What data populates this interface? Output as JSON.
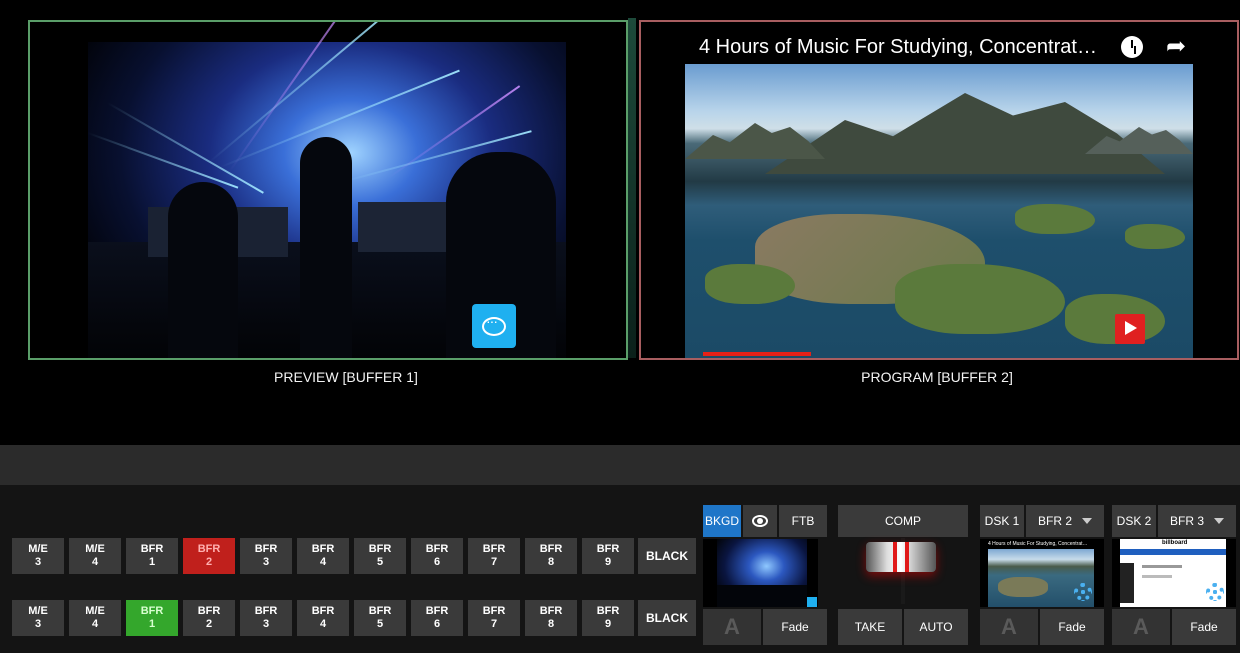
{
  "monitors": {
    "preview": {
      "label": "PREVIEW [BUFFER 1]"
    },
    "program": {
      "label": "PROGRAM [BUFFER 2]",
      "video_title": "4 Hours of Music For Studying, Concentrat…"
    }
  },
  "bus_rows": {
    "program_row": [
      {
        "l1": "M/E",
        "l2": "3",
        "state": "off"
      },
      {
        "l1": "M/E",
        "l2": "4",
        "state": "off"
      },
      {
        "l1": "BFR",
        "l2": "1",
        "state": "off"
      },
      {
        "l1": "BFR",
        "l2": "2",
        "state": "red"
      },
      {
        "l1": "BFR",
        "l2": "3",
        "state": "off"
      },
      {
        "l1": "BFR",
        "l2": "4",
        "state": "off"
      },
      {
        "l1": "BFR",
        "l2": "5",
        "state": "off"
      },
      {
        "l1": "BFR",
        "l2": "6",
        "state": "off"
      },
      {
        "l1": "BFR",
        "l2": "7",
        "state": "off"
      },
      {
        "l1": "BFR",
        "l2": "8",
        "state": "off"
      },
      {
        "l1": "BFR",
        "l2": "9",
        "state": "off"
      },
      {
        "l1": "BLACK",
        "l2": "",
        "state": "off"
      }
    ],
    "preview_row": [
      {
        "l1": "M/E",
        "l2": "3",
        "state": "off"
      },
      {
        "l1": "M/E",
        "l2": "4",
        "state": "off"
      },
      {
        "l1": "BFR",
        "l2": "1",
        "state": "green"
      },
      {
        "l1": "BFR",
        "l2": "2",
        "state": "off"
      },
      {
        "l1": "BFR",
        "l2": "3",
        "state": "off"
      },
      {
        "l1": "BFR",
        "l2": "4",
        "state": "off"
      },
      {
        "l1": "BFR",
        "l2": "5",
        "state": "off"
      },
      {
        "l1": "BFR",
        "l2": "6",
        "state": "off"
      },
      {
        "l1": "BFR",
        "l2": "7",
        "state": "off"
      },
      {
        "l1": "BFR",
        "l2": "8",
        "state": "off"
      },
      {
        "l1": "BFR",
        "l2": "9",
        "state": "off"
      },
      {
        "l1": "BLACK",
        "l2": "",
        "state": "off"
      }
    ]
  },
  "bkgd_block": {
    "bkgd_label": "BKGD",
    "ftb_label": "FTB",
    "a_label": "A",
    "fade_label": "Fade"
  },
  "comp_block": {
    "comp_label": "COMP",
    "take_label": "TAKE",
    "auto_label": "AUTO"
  },
  "dsk1": {
    "label": "DSK 1",
    "source": "BFR 2",
    "a_label": "A",
    "fade_label": "Fade",
    "thumb_title": "4 Hours of Music For Studying, Concentrat…"
  },
  "dsk2": {
    "label": "DSK 2",
    "source": "BFR 3",
    "a_label": "A",
    "fade_label": "Fade",
    "thumb_title": "billboard"
  },
  "colors": {
    "preview_border": "#5a9e69",
    "program_border": "#a85e60",
    "tally_red": "#c0201c",
    "tally_green": "#34a72c",
    "accent_blue": "#1f76c8"
  }
}
